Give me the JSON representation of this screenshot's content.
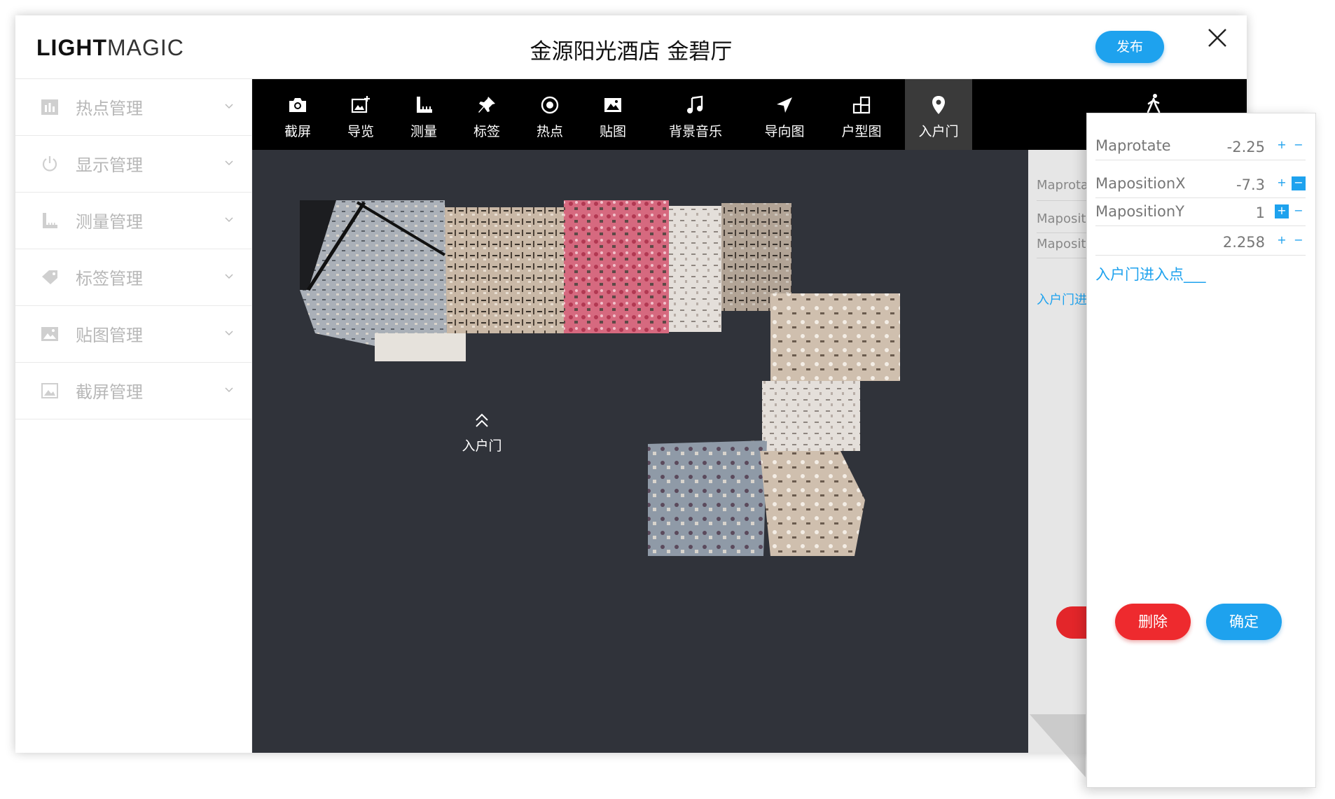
{
  "header": {
    "logo_bold": "LIGHT",
    "logo_light": "MAGIC",
    "title": "金源阳光酒店 金碧厅",
    "publish_label": "发布"
  },
  "sidebar": {
    "items": [
      {
        "label": "热点管理",
        "icon": "bar-chart-icon"
      },
      {
        "label": "显示管理",
        "icon": "power-icon"
      },
      {
        "label": "测量管理",
        "icon": "ruler-icon"
      },
      {
        "label": "标签管理",
        "icon": "tag-icon"
      },
      {
        "label": "贴图管理",
        "icon": "image-icon"
      },
      {
        "label": "截屏管理",
        "icon": "screenshot-icon"
      }
    ]
  },
  "toolbar": {
    "tools": [
      {
        "label": "截屏",
        "icon": "camera-icon"
      },
      {
        "label": "导览",
        "icon": "image-plus-icon"
      },
      {
        "label": "测量",
        "icon": "ruler-icon"
      },
      {
        "label": "标签",
        "icon": "pin-icon"
      },
      {
        "label": "热点",
        "icon": "target-icon"
      },
      {
        "label": "贴图",
        "icon": "image-icon"
      },
      {
        "label": "背景音乐",
        "icon": "music-icon"
      },
      {
        "label": "导向图",
        "icon": "navigation-icon"
      },
      {
        "label": "户型图",
        "icon": "floorplan-icon"
      },
      {
        "label": "入户门",
        "icon": "location-pin-icon",
        "active": true
      }
    ],
    "walk_icon": "walking-person-icon"
  },
  "viewport": {
    "marker_label": "入户门"
  },
  "back_panel": {
    "rows": [
      "Maprota",
      "Mapositi",
      "Mapositi"
    ],
    "link": "入户门进"
  },
  "panel": {
    "rows": [
      {
        "label": "Maprotate",
        "value": "-2.25"
      },
      {
        "label": "MapositionX",
        "value": "-7.3"
      },
      {
        "label": "MapositionY",
        "value": "1"
      },
      {
        "label": "",
        "value": "2.258"
      }
    ],
    "link": "入户门进入点___",
    "delete_label": "删除",
    "confirm_label": "确定"
  },
  "colors": {
    "accent": "#1ea2ee",
    "danger": "#ee2a2e",
    "toolbar": "#000000",
    "viewport": "#30333a"
  }
}
